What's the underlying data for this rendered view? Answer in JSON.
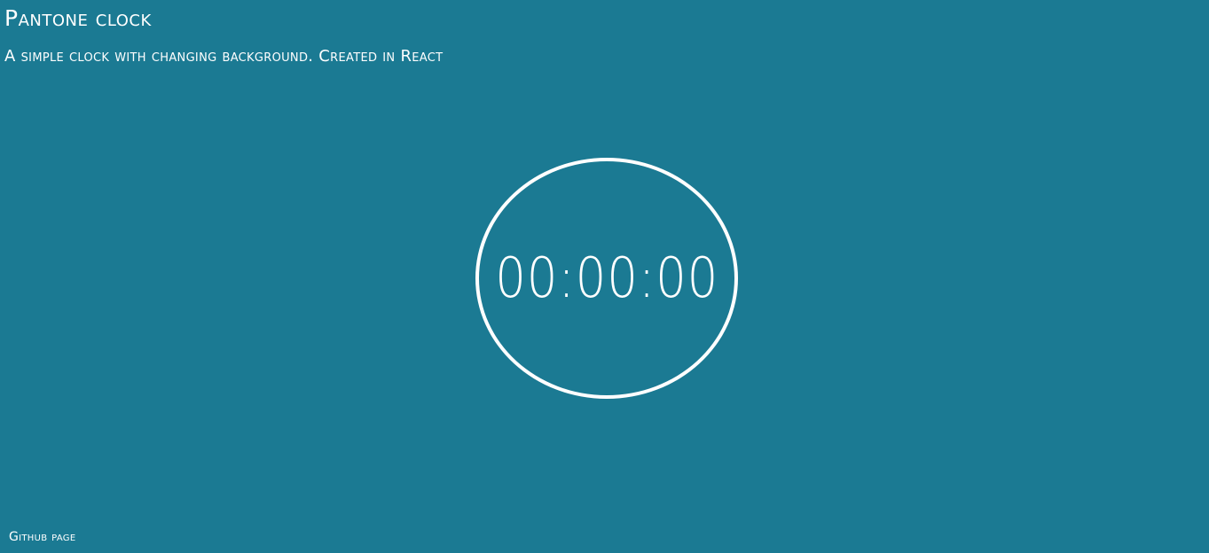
{
  "header": {
    "title": "Pantone clock",
    "subtitle": "A simple clock with changing background. Created in React"
  },
  "clock": {
    "time": "00:00:00"
  },
  "footer": {
    "link_label": "Github page"
  },
  "colors": {
    "background": "#1b7a93",
    "foreground": "#ffffff"
  }
}
